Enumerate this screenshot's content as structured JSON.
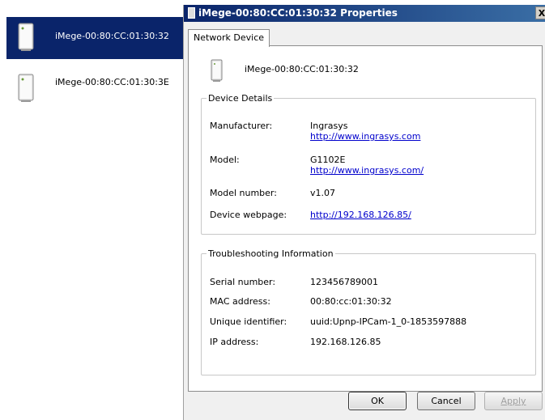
{
  "device_list": {
    "items": [
      {
        "label": "iMege-00:80:CC:01:30:32",
        "selected": true,
        "icon": "network-device-icon"
      },
      {
        "label": "iMege-00:80:CC:01:30:3E",
        "selected": false,
        "icon": "network-device-icon"
      }
    ]
  },
  "dialog": {
    "title": "iMege-00:80:CC:01:30:32 Properties",
    "close_label": "X",
    "tab_label": "Network Device",
    "device_name": "iMege-00:80:CC:01:30:32",
    "details": {
      "legend": "Device Details",
      "manufacturer_label": "Manufacturer:",
      "manufacturer_value": "Ingrasys",
      "manufacturer_url": "http://www.ingrasys.com",
      "model_label": "Model:",
      "model_value": "G1102E",
      "model_url": "http://www.ingrasys.com/",
      "model_number_label": "Model number:",
      "model_number_value": "v1.07",
      "webpage_label": "Device webpage:",
      "webpage_url": "http://192.168.126.85/"
    },
    "troubleshooting": {
      "legend": "Troubleshooting Information",
      "serial_label": "Serial number:",
      "serial_value": "123456789001",
      "mac_label": "MAC address:",
      "mac_value": "00:80:cc:01:30:32",
      "uid_label": "Unique identifier:",
      "uid_value": "uuid:Upnp-IPCam-1_0-1853597888",
      "ip_label": "IP address:",
      "ip_value": "192.168.126.85"
    },
    "buttons": {
      "ok": "OK",
      "cancel": "Cancel",
      "apply": "Apply"
    }
  },
  "colors": {
    "selection": "#0a246a",
    "titlebar": "#0a246a",
    "link": "#0000cc"
  }
}
